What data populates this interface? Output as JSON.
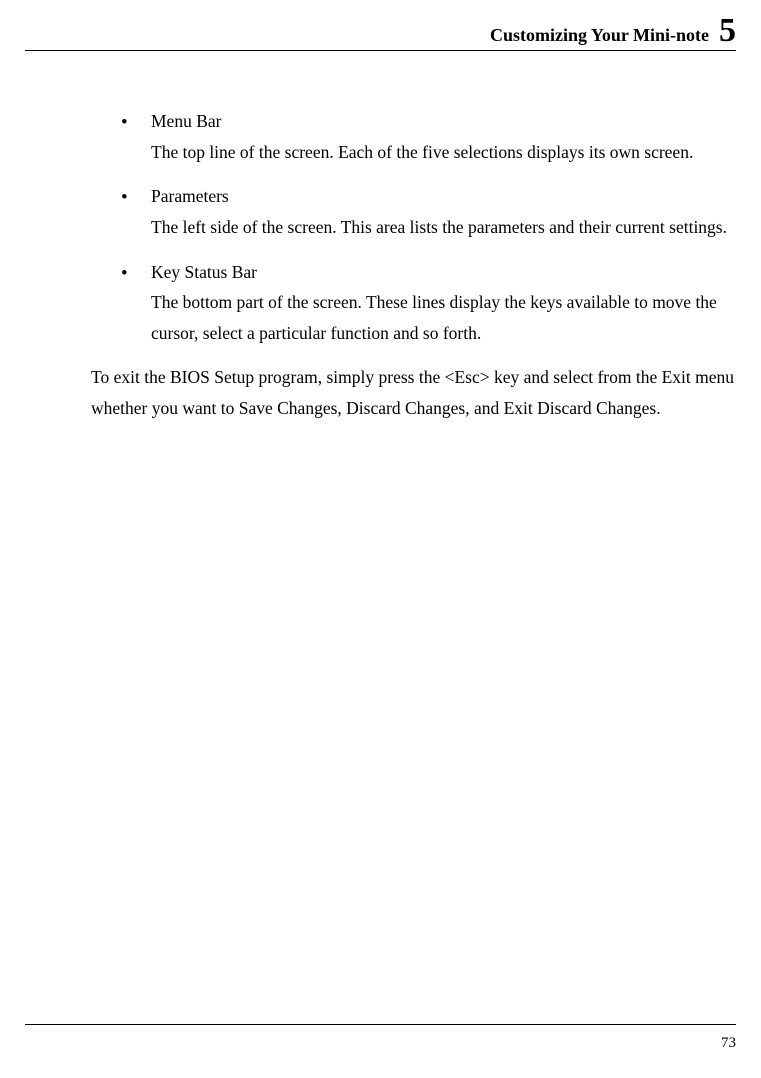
{
  "header": {
    "title": "Customizing Your Mini-note",
    "chapter": "5"
  },
  "bullets": [
    {
      "title": "Menu Bar",
      "desc": "The top line of the screen. Each of the five selections displays its own screen."
    },
    {
      "title": "Parameters",
      "desc": "The left side of the screen. This area lists the parameters and their current settings."
    },
    {
      "title": "Key Status Bar",
      "desc": "The bottom part of the screen. These lines display the keys available to move the cursor, select a particular function and so forth."
    }
  ],
  "paragraph": "To exit the BIOS Setup program, simply press the <Esc> key and select from the Exit menu whether you want to Save Changes, Discard Changes, and Exit Discard Changes.",
  "footer": {
    "page_number": "73"
  }
}
